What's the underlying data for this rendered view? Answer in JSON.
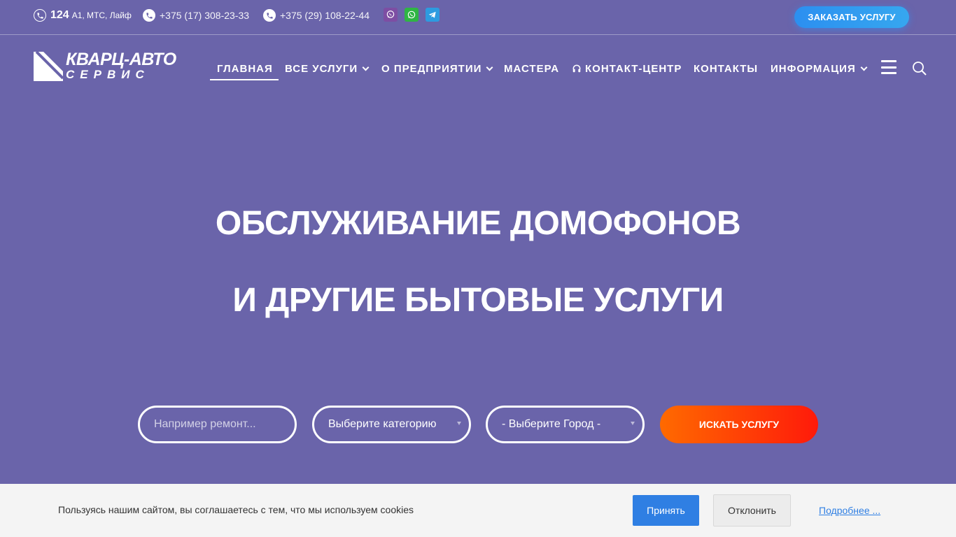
{
  "topbar": {
    "short_number": "124",
    "short_operators": "А1, МТС, Лайф",
    "phone1": "+375 (17) 308-23-33",
    "phone2": "+375 (29) 108-22-44",
    "messengers": [
      "viber-icon",
      "whatsapp-icon",
      "telegram-icon"
    ],
    "order_button": "ЗАКАЗАТЬ УСЛУГУ"
  },
  "logo": {
    "line1": "КВАРЦ-АВТО",
    "line2": "СЕРВИС"
  },
  "nav": {
    "items": [
      {
        "label": "ГЛАВНАЯ",
        "active": true,
        "dropdown": false
      },
      {
        "label": "ВСЕ УСЛУГИ",
        "active": false,
        "dropdown": true
      },
      {
        "label": "О ПРЕДПРИЯТИИ",
        "active": false,
        "dropdown": true
      },
      {
        "label": "МАСТЕРА",
        "active": false,
        "dropdown": false
      },
      {
        "label": "КОНТАКТ-ЦЕНТР",
        "active": false,
        "dropdown": false,
        "icon": "headphones-icon"
      },
      {
        "label": "КОНТАКТЫ",
        "active": false,
        "dropdown": false
      },
      {
        "label": "ИНФОРМАЦИЯ",
        "active": false,
        "dropdown": true
      }
    ]
  },
  "hero": {
    "line1": "ОБСЛУЖИВАНИЕ ДОМОФОНОВ",
    "line2": "И ДРУГИЕ БЫТОВЫЕ УСЛУГИ"
  },
  "search": {
    "query_placeholder": "Например ремонт...",
    "query_value": "",
    "category_selected": "Выберите категорию",
    "city_selected": "- Выберите Город -",
    "button": "ИСКАТЬ УСЛУГУ"
  },
  "cookie": {
    "text": "Пользуясь нашим сайтом, вы соглашаетесь с тем, что мы используем cookies",
    "accept": "Принять",
    "decline": "Отклонить",
    "more": "Подробнее ..."
  },
  "colors": {
    "background": "#6a64aa",
    "order_button": "#2c8ff0",
    "search_button": "#ff4a05",
    "accept_button": "#2f7fe3",
    "viber": "#7d4ea3",
    "whatsapp": "#2fb544",
    "telegram": "#2d9be0"
  }
}
